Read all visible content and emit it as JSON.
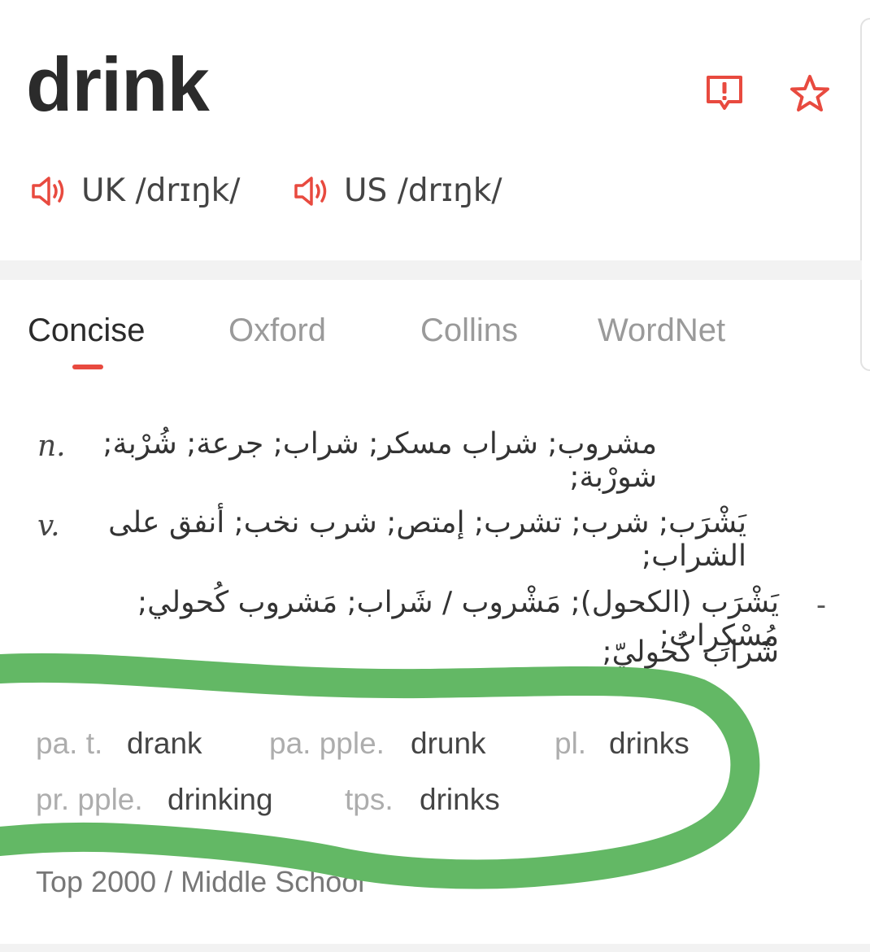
{
  "entry": {
    "word": "drink",
    "icons": {
      "report": "report-icon",
      "favorite": "star-icon",
      "audio": "speaker-icon"
    },
    "accent_color": "#e84a3f"
  },
  "pronunciations": [
    {
      "text": "UK /drɪŋk/"
    },
    {
      "text": "US /drɪŋk/"
    }
  ],
  "tabs": [
    {
      "label": "Concise",
      "active": true
    },
    {
      "label": "Oxford",
      "active": false
    },
    {
      "label": "Collins",
      "active": false
    },
    {
      "label": "WordNet",
      "active": false
    }
  ],
  "definitions": [
    {
      "pos": "n.",
      "text": "مشروب; شراب مسكر; شراب; جرعة; شُرْبة; شورْبة;"
    },
    {
      "pos": "v.",
      "text": "يَشْرَب; شرب; تشرب; إمتص; شرب نخب; أنفق على الشراب;"
    },
    {
      "pos": "-",
      "line1": "يَشْرَب (الكحول); مَشْروب / شَراب; مَشروب كُحولي; مُسْكِرات;",
      "line2": "شَراب كُحوليّ;"
    }
  ],
  "forms": [
    {
      "label": "pa. t.",
      "value": "drank"
    },
    {
      "label": "pa. pple.",
      "value": "drunk"
    },
    {
      "label": "pl.",
      "value": "drinks"
    },
    {
      "label": "pr. pple.",
      "value": "drinking"
    },
    {
      "label": "tps.",
      "value": "drinks"
    }
  ],
  "level": "Top 2000 / Middle School",
  "annotation": {
    "color": "#63b865"
  }
}
